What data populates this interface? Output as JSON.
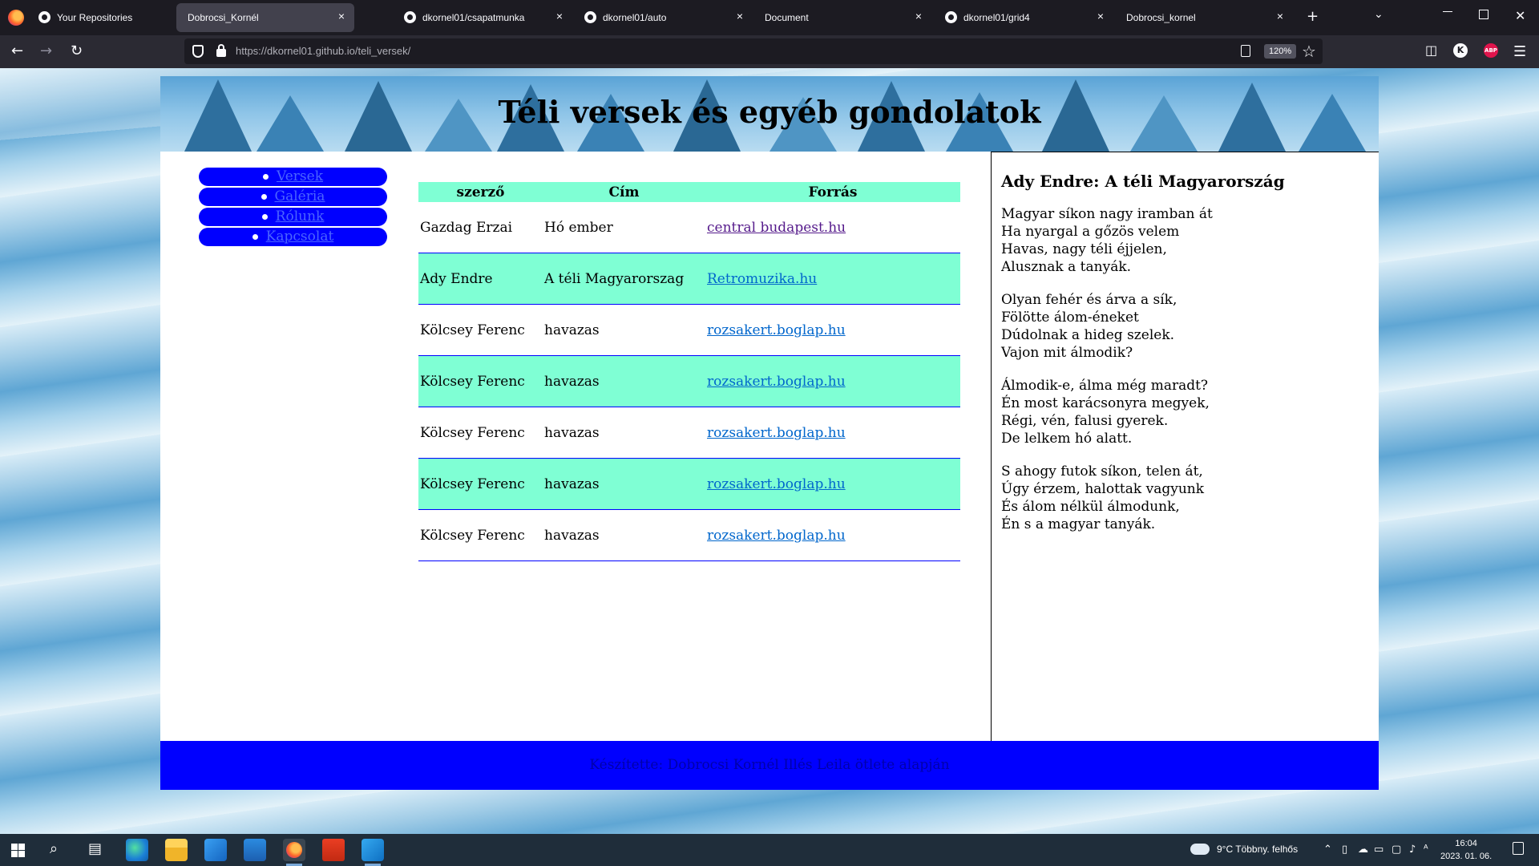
{
  "browser": {
    "tabs": [
      {
        "label": "Your Repositories",
        "favicon": "github-icon"
      },
      {
        "label": "Dobrocsi_Kornél",
        "favicon": "none",
        "active": true
      },
      {
        "label": "dkornel01/csapatmunka",
        "favicon": "github-icon"
      },
      {
        "label": "dkornel01/auto",
        "favicon": "github-icon"
      },
      {
        "label": "Document",
        "favicon": "none"
      },
      {
        "label": "dkornel01/grid4",
        "favicon": "github-icon"
      },
      {
        "label": "Dobrocsi_kornel",
        "favicon": "none"
      }
    ],
    "tab_close": "×",
    "new_tab": "+",
    "url_host": "https://dkornel01.github.io/",
    "url_path": "teli_versek/",
    "zoom": "120%"
  },
  "page": {
    "title": "Téli versek és egyéb gondolatok",
    "nav": [
      "Versek",
      "Galéria",
      "Rólunk",
      "Kapcsolat"
    ],
    "table": {
      "headers": [
        "szerző",
        "Cím",
        "Forrás"
      ],
      "rows": [
        {
          "author": "Gazdag Erzai",
          "title": "Hó ember",
          "source": "central budapest.hu"
        },
        {
          "author": "Ady Endre",
          "title": "A téli Magyarorszag",
          "source": "Retromuzika.hu"
        },
        {
          "author": "Kölcsey Ferenc",
          "title": "havazas",
          "source": "rozsakert.boglap.hu"
        },
        {
          "author": "Kölcsey Ferenc",
          "title": "havazas",
          "source": "rozsakert.boglap.hu"
        },
        {
          "author": "Kölcsey Ferenc",
          "title": "havazas",
          "source": "rozsakert.boglap.hu"
        },
        {
          "author": "Kölcsey Ferenc",
          "title": "havazas",
          "source": "rozsakert.boglap.hu"
        },
        {
          "author": "Kölcsey Ferenc",
          "title": "havazas",
          "source": "rozsakert.boglap.hu"
        }
      ]
    },
    "aside": {
      "poem_title": "Ady Endre: A téli Magyarország",
      "stanzas": [
        [
          "Magyar síkon nagy iramban át",
          "Ha nyargal a gőzös velem",
          "Havas, nagy téli éjjelen,",
          "Alusznak a tanyák."
        ],
        [
          "Olyan fehér és árva a sík,",
          "Fölötte álom-éneket",
          "Dúdolnak a hideg szelek.",
          "Vajon mit álmodik?"
        ],
        [
          "Álmodik-e, álma még maradt?",
          "Én most karácsonyra megyek,",
          "Régi, vén, falusi gyerek.",
          "De lelkem hó alatt."
        ],
        [
          "S ahogy futok síkon, telen át,",
          "Úgy érzem, halottak vagyunk",
          "És álom nélkül álmodunk,",
          "Én s a magyar tanyák."
        ]
      ]
    },
    "footer": "Készítette: Dobrocsi Kornél Illés Leila ötlete alapján"
  },
  "taskbar": {
    "weather": "9°C  Többny. felhős",
    "time": "16:04",
    "date": "2023. 01. 06."
  },
  "colors": {
    "nav_bg": "#0000ff",
    "table_accent": "#7fffd4",
    "footer_bg": "#0000ff",
    "banner": "#5aa3d6"
  }
}
